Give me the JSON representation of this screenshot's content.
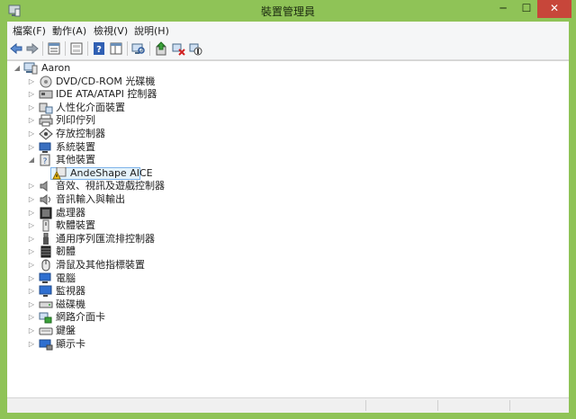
{
  "window": {
    "title": "裝置管理員",
    "min_glyph": "─",
    "max_glyph": "☐",
    "close_glyph": "✕"
  },
  "menu": [
    {
      "label": "檔案(F)"
    },
    {
      "label": "動作(A)"
    },
    {
      "label": "檢視(V)"
    },
    {
      "label": "說明(H)"
    }
  ],
  "toolbar": [
    {
      "name": "back-icon"
    },
    {
      "name": "forward-icon"
    },
    {
      "name": "properties-icon"
    },
    {
      "name": "show-hidden-icon"
    },
    {
      "name": "help-icon"
    },
    {
      "name": "view-panel-icon"
    },
    {
      "name": "scan-hardware-icon"
    },
    {
      "name": "update-driver-icon"
    },
    {
      "name": "uninstall-icon"
    },
    {
      "name": "disable-device-icon"
    }
  ],
  "tree": {
    "root": {
      "label": "Aaron",
      "expanded": true,
      "icon": "computer-icon"
    },
    "items": [
      {
        "label": "DVD/CD-ROM 光碟機",
        "icon": "dvd-drive-icon",
        "expanded": false
      },
      {
        "label": "IDE ATA/ATAPI 控制器",
        "icon": "ide-controller-icon",
        "expanded": false
      },
      {
        "label": "人性化介面裝置",
        "icon": "hid-icon",
        "expanded": false
      },
      {
        "label": "列印佇列",
        "icon": "printer-icon",
        "expanded": false
      },
      {
        "label": "存放控制器",
        "icon": "storage-controller-icon",
        "expanded": false
      },
      {
        "label": "系統裝置",
        "icon": "system-device-icon",
        "expanded": false
      },
      {
        "label": "其他裝置",
        "icon": "other-devices-icon",
        "expanded": true,
        "children": [
          {
            "label": "AndeShape AICE",
            "icon": "warning-device-icon",
            "selected": true
          }
        ]
      },
      {
        "label": "音效、視訊及遊戲控制器",
        "icon": "sound-icon",
        "expanded": false
      },
      {
        "label": "音訊輸入與輸出",
        "icon": "audio-io-icon",
        "expanded": false
      },
      {
        "label": "處理器",
        "icon": "processor-icon",
        "expanded": false
      },
      {
        "label": "軟體裝置",
        "icon": "software-device-icon",
        "expanded": false
      },
      {
        "label": "通用序列匯流排控制器",
        "icon": "usb-icon",
        "expanded": false
      },
      {
        "label": "韌體",
        "icon": "firmware-icon",
        "expanded": false
      },
      {
        "label": "滑鼠及其他指標裝置",
        "icon": "mouse-icon",
        "expanded": false
      },
      {
        "label": "電腦",
        "icon": "computer-node-icon",
        "expanded": false
      },
      {
        "label": "監視器",
        "icon": "monitor-icon",
        "expanded": false
      },
      {
        "label": "磁碟機",
        "icon": "disk-drive-icon",
        "expanded": false
      },
      {
        "label": "網路介面卡",
        "icon": "network-adapter-icon",
        "expanded": false
      },
      {
        "label": "鍵盤",
        "icon": "keyboard-icon",
        "expanded": false
      },
      {
        "label": "顯示卡",
        "icon": "display-adapter-icon",
        "expanded": false
      }
    ]
  },
  "colors": {
    "frame": "#8fc357",
    "close": "#c7463a",
    "selection_bg": "#e5f3fb",
    "selection_border": "#7eb4ea"
  }
}
